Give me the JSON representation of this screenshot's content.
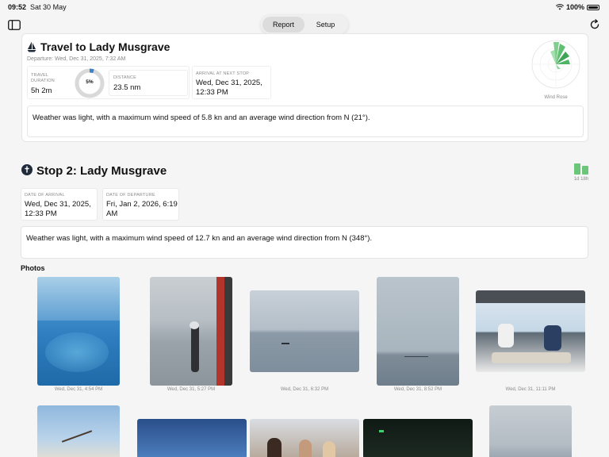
{
  "status_bar": {
    "time": "09:52",
    "date": "Sat 30 May",
    "battery": "100%"
  },
  "toolbar": {
    "segments": [
      {
        "label": "Report",
        "active": true
      },
      {
        "label": "Setup",
        "active": false
      }
    ],
    "left_icon": "sidebar-toggle-icon",
    "right_icon": "refresh-icon"
  },
  "leg": {
    "title": "Travel to Lady Musgrave",
    "departure": "Departure: Wed, Dec 31, 2025, 7:32 AM",
    "travel_duration_label": "TRAVEL DURATION",
    "travel_duration": "5h 2m",
    "progress_text": "5%",
    "progress_fraction": 0.05,
    "distance_label": "DISTANCE",
    "distance": "23.5 nm",
    "arrival_label": "ARRIVAL AT NEXT STOP",
    "arrival": "Wed, Dec 31, 2025, 12:33 PM",
    "wind_rose_label": "Wind Rose",
    "note": "Weather was light, with a maximum wind speed of 5.8 kn and an average wind direction from N (21°)."
  },
  "stop": {
    "title": "Stop 2: Lady Musgrave",
    "duration_badge": "1d 18h",
    "date_of_arrival_label": "DATE OF ARRIVAL",
    "date_of_arrival": "Wed, Dec 31, 2025, 12:33 PM",
    "date_of_departure_label": "DATE OF DEPARTURE",
    "date_of_departure": "Fri, Jan 2, 2026, 6:19 AM",
    "note": "Weather was light, with a maximum wind speed of 12.7 kn and an average wind direction from N (348°)."
  },
  "photos": {
    "heading": "Photos",
    "items": [
      {
        "date": "Wed, Dec 31, 4:54 PM"
      },
      {
        "date": "Wed, Dec 31, 5:27 PM"
      },
      {
        "date": "Wed, Dec 31, 6:32 PM"
      },
      {
        "date": "Wed, Dec 31, 8:52 PM"
      },
      {
        "date": "Wed, Dec 31, 11:11 PM"
      }
    ]
  }
}
